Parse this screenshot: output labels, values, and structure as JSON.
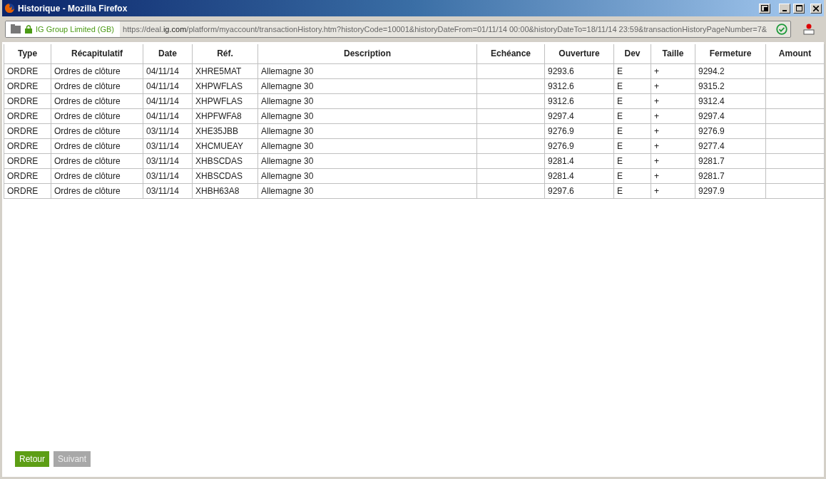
{
  "window": {
    "title": "Historique - Mozilla Firefox"
  },
  "address_bar": {
    "identity": "IG Group Limited (GB)",
    "url_prefix": "https://deal.",
    "url_domain": "ig.com",
    "url_rest": "/platform/myaccount/transactionHistory.htm?historyCode=10001&historyDateFrom=01/11/14 00:00&historyDateTo=18/11/14 23:59&transactionHistoryPageNumber=7&"
  },
  "table": {
    "columns": [
      "Type",
      "Récapitulatif",
      "Date",
      "Réf.",
      "Description",
      "Echéance",
      "Ouverture",
      "Dev",
      "Taille",
      "Fermeture",
      "Amount"
    ],
    "rows": [
      {
        "type": "ORDRE",
        "summary": "Ordres de clôture",
        "date": "04/11/14",
        "ref": "XHRE5MAT",
        "description": "Allemagne 30",
        "open": "9293.6",
        "currency": "E",
        "size": "+",
        "close": "9294.2"
      },
      {
        "type": "ORDRE",
        "summary": "Ordres de clôture",
        "date": "04/11/14",
        "ref": "XHPWFLAS",
        "description": "Allemagne 30",
        "open": "9312.6",
        "currency": "E",
        "size": "+",
        "close": "9315.2"
      },
      {
        "type": "ORDRE",
        "summary": "Ordres de clôture",
        "date": "04/11/14",
        "ref": "XHPWFLAS",
        "description": "Allemagne 30",
        "open": "9312.6",
        "currency": "E",
        "size": "+",
        "close": "9312.4"
      },
      {
        "type": "ORDRE",
        "summary": "Ordres de clôture",
        "date": "04/11/14",
        "ref": "XHPFWFA8",
        "description": "Allemagne 30",
        "open": "9297.4",
        "currency": "E",
        "size": "+",
        "close": "9297.4"
      },
      {
        "type": "ORDRE",
        "summary": "Ordres de clôture",
        "date": "03/11/14",
        "ref": "XHE35JBB",
        "description": "Allemagne 30",
        "open": "9276.9",
        "currency": "E",
        "size": "+",
        "close": "9276.9"
      },
      {
        "type": "ORDRE",
        "summary": "Ordres de clôture",
        "date": "03/11/14",
        "ref": "XHCMUEAY",
        "description": "Allemagne 30",
        "open": "9276.9",
        "currency": "E",
        "size": "+",
        "close": "9277.4"
      },
      {
        "type": "ORDRE",
        "summary": "Ordres de clôture",
        "date": "03/11/14",
        "ref": "XHBSCDAS",
        "description": "Allemagne 30",
        "open": "9281.4",
        "currency": "E",
        "size": "+",
        "close": "9281.7"
      },
      {
        "type": "ORDRE",
        "summary": "Ordres de clôture",
        "date": "03/11/14",
        "ref": "XHBSCDAS",
        "description": "Allemagne 30",
        "open": "9281.4",
        "currency": "E",
        "size": "+",
        "close": "9281.7"
      },
      {
        "type": "ORDRE",
        "summary": "Ordres de clôture",
        "date": "03/11/14",
        "ref": "XHBH63A8",
        "description": "Allemagne 30",
        "open": "9297.6",
        "currency": "E",
        "size": "+",
        "close": "9297.9"
      }
    ]
  },
  "buttons": [
    {
      "label": "Retour",
      "disabled": false
    },
    {
      "label": "Suivant",
      "disabled": true
    }
  ]
}
